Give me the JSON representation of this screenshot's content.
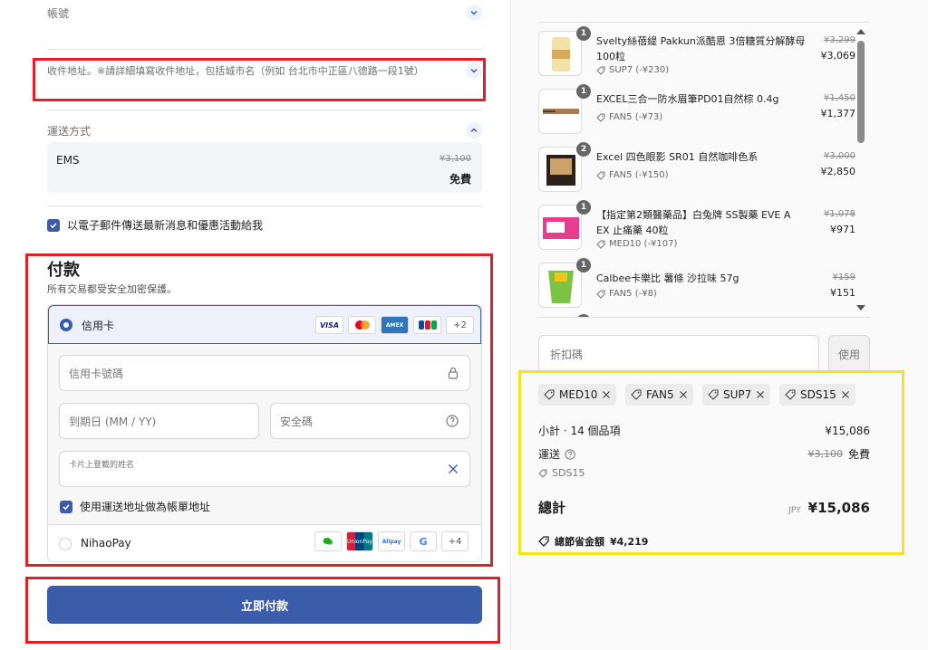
{
  "account": {
    "label": "帳號"
  },
  "address": {
    "placeholder": "收件地址。※請詳細填寫收件地址，包括城市名（例如 台北市中正區八德路一段1號）"
  },
  "shipping": {
    "title": "運送方式",
    "method": "EMS",
    "original_price": "¥3,100",
    "price": "免費"
  },
  "newsletter": {
    "label": "以電子郵件傳送最新消息和優惠活動給我",
    "checked": true
  },
  "payment": {
    "title": "付款",
    "subtitle": "所有交易都受安全加密保護。",
    "credit_card": {
      "label": "信用卡",
      "selected": true,
      "logos": [
        "VISA",
        "Mastercard",
        "AMEX",
        "JCB"
      ],
      "more": "+2",
      "card_number_placeholder": "信用卡號碼",
      "expiry_placeholder": "到期日 (MM / YY)",
      "cvv_placeholder": "安全碼",
      "name_label": "卡片上登載的姓名",
      "billing_same": "使用運送地址做為帳單地址"
    },
    "nihaopay": {
      "label": "NihaoPay",
      "logos": [
        "WeChat Pay",
        "UnionPay",
        "Alipay",
        "G"
      ],
      "more": "+4"
    },
    "pay_button": "立即付款"
  },
  "cart": {
    "items": [
      {
        "qty": "1",
        "name": "Svelty絲蓓緹 Pakkun派酷恩 3倍糖質分解酵母 100粒",
        "discount": "SUP7 (-¥230)",
        "original": "¥3,299",
        "price": "¥3,069"
      },
      {
        "qty": "1",
        "name": "EXCEL三合一防水眉筆PD01自然棕 0.4g",
        "discount": "FAN5 (-¥73)",
        "original": "¥1,450",
        "price": "¥1,377"
      },
      {
        "qty": "2",
        "name": "Excel 四色眼影 SR01 自然咖啡色系",
        "discount": "FAN5 (-¥150)",
        "original": "¥3,000",
        "price": "¥2,850"
      },
      {
        "qty": "1",
        "name": "【指定第2類醫藥品】白兔牌 SS製藥 EVE A EX 止痛藥 40粒",
        "discount": "MED10 (-¥107)",
        "original": "¥1,078",
        "price": "¥971"
      },
      {
        "qty": "1",
        "name": "Calbee卡樂比 薯條 沙拉味 57g",
        "discount": "FAN5 (-¥8)",
        "original": "¥159",
        "price": "¥151"
      }
    ]
  },
  "discount": {
    "placeholder": "折扣碼",
    "apply": "使用",
    "codes": [
      "MED10",
      "FAN5",
      "SUP7",
      "SDS15"
    ]
  },
  "summary": {
    "subtotal_label": "小計 · 14 個品項",
    "subtotal": "¥15,086",
    "shipping_label": "運送",
    "shipping_original": "¥3,100",
    "shipping_price": "免費",
    "shipping_code": "SDS15",
    "total_label": "總計",
    "currency": "JPY",
    "total": "¥15,086",
    "savings_label": "總節省金額",
    "savings": "¥4,219"
  },
  "colors": {
    "accent": "#3b5ca8",
    "highlight_red": "#e11f26",
    "highlight_yellow": "#f5e21e"
  }
}
